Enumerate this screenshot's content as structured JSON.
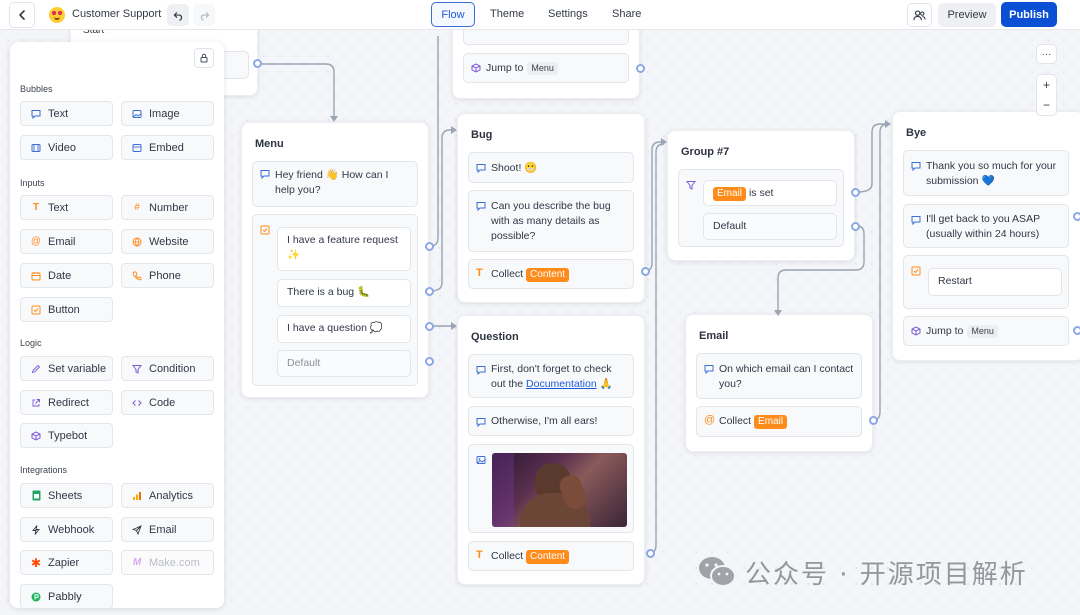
{
  "topbar": {
    "bot_name": "Customer Support",
    "tabs": [
      "Flow",
      "Theme",
      "Settings",
      "Share"
    ],
    "preview_label": "Preview",
    "publish_label": "Publish"
  },
  "sidebar": {
    "sections": {
      "bubbles": "Bubbles",
      "inputs": "Inputs",
      "logic": "Logic",
      "integrations": "Integrations"
    },
    "bubbles": [
      "Text",
      "Image",
      "Video",
      "Embed"
    ],
    "inputs": [
      "Text",
      "Number",
      "Email",
      "Website",
      "Date",
      "Phone",
      "Button"
    ],
    "logic": [
      "Set variable",
      "Condition",
      "Redirect",
      "Code",
      "Typebot"
    ],
    "integrations": [
      "Sheets",
      "Analytics",
      "Webhook",
      "Email",
      "Zapier",
      "Make.com",
      "Pabbly"
    ]
  },
  "canvas": {
    "start_title": "Start",
    "top_jump": {
      "label": "Jump to",
      "target": "Menu"
    },
    "menu": {
      "title": "Menu",
      "greeting": "Hey friend 👋 How can I help you?",
      "choices": [
        "I have a feature request ✨",
        "There is a bug 🐛",
        "I have a question 💭",
        "Default"
      ]
    },
    "bug": {
      "title": "Bug",
      "text1": "Shoot! 😬",
      "text2": "Can you describe the bug with as many details as possible?",
      "collect": "Collect",
      "var": "Content"
    },
    "question": {
      "title": "Question",
      "text1_pre": "First, don't forget to check out the ",
      "text1_link": "Documentation",
      "text1_post": " 🙏",
      "text2": "Otherwise, I'm all ears!",
      "collect": "Collect",
      "var": "Content"
    },
    "group7": {
      "title": "Group #7",
      "var": "Email",
      "condition": "is set",
      "default": "Default"
    },
    "email": {
      "title": "Email",
      "text": "On which email can I contact you?",
      "collect": "Collect",
      "var": "Email"
    },
    "bye": {
      "title": "Bye",
      "text1": "Thank you so much for your submission 💙",
      "text2": "I'll get back to you ASAP (usually within 24 hours)",
      "restart": "Restart",
      "jump": "Jump to",
      "target": "Menu"
    }
  },
  "zoom": {
    "more": "···",
    "plus": "+",
    "minus": "−"
  },
  "watermark": "公众号 · 开源项目解析",
  "colors": {
    "accent": "#0a4fd4",
    "variable_tag": "#ff8b1a",
    "port": "#8aa7e6"
  }
}
